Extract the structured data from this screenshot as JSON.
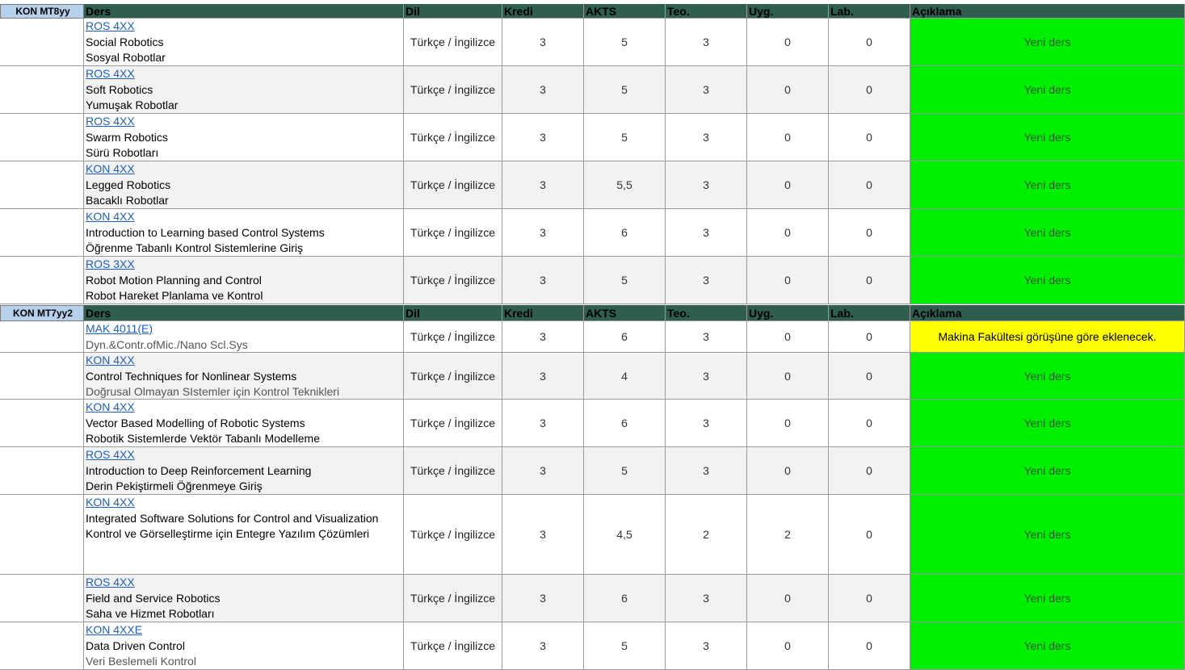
{
  "sections": [
    {
      "label": "KON MT8yy",
      "headers": [
        "Ders",
        "Dil",
        "Kredi",
        "AKTS",
        "Teo.",
        "Uyg.",
        "Lab.",
        "Açıklama"
      ],
      "rows": [
        {
          "code": "ROS 4XX ",
          "en": "Social Robotics",
          "tr": "Sosyal Robotlar",
          "dil": "Türkçe / İngilizce",
          "kredi": "3",
          "akts": "5",
          "teo": "3",
          "uyg": "0",
          "lab": "0",
          "aciklama": "Yeni ders",
          "status": "green"
        },
        {
          "code": "ROS 4XX ",
          "en": "Soft Robotics",
          "tr": "Yumuşak Robotlar",
          "dil": "Türkçe / İngilizce",
          "kredi": "3",
          "akts": "5",
          "teo": "3",
          "uyg": "0",
          "lab": "0",
          "aciklama": "Yeni ders",
          "status": "green"
        },
        {
          "code": "ROS 4XX ",
          "en": "Swarm Robotics",
          "tr": "Sürü Robotları",
          "dil": "Türkçe / İngilizce",
          "kredi": "3",
          "akts": "5",
          "teo": "3",
          "uyg": "0",
          "lab": "0",
          "aciklama": "Yeni ders",
          "status": "green"
        },
        {
          "code": "KON 4XX",
          "en": "Legged Robotics",
          "tr": "Bacaklı Robotlar",
          "dil": "Türkçe / İngilizce",
          "kredi": "3",
          "akts": "5,5",
          "teo": "3",
          "uyg": "0",
          "lab": "0",
          "aciklama": "Yeni ders",
          "status": "green"
        },
        {
          "code": "KON 4XX",
          "en": "Introduction to Learning based Control Systems",
          "tr": "Öğrenme Tabanlı Kontrol Sistemlerine Giriş",
          "dil": "Türkçe / İngilizce",
          "kredi": "3",
          "akts": "6",
          "teo": "3",
          "uyg": "0",
          "lab": "0",
          "aciklama": "Yeni ders",
          "status": "green"
        },
        {
          "code": "ROS 3XX",
          "en": "Robot Motion Planning and Control",
          "tr": "Robot Hareket Planlama ve Kontrol",
          "dil": "Türkçe / İngilizce",
          "kredi": "3",
          "akts": "5",
          "teo": "3",
          "uyg": "0",
          "lab": "0",
          "aciklama": "Yeni ders",
          "status": "green"
        }
      ]
    },
    {
      "label": "KON MT7yy2",
      "headers": [
        "Ders",
        "Dil",
        "Kredi",
        "AKTS",
        "Teo.",
        "Uyg.",
        "Lab.",
        "Açıklama"
      ],
      "rows": [
        {
          "code": "MAK 4011(E)",
          "en": "Dyn.&Contr.ofMic./Nano Scl.Sys",
          "tr": "",
          "dil": "Türkçe / İngilizce",
          "kredi": "3",
          "akts": "6",
          "teo": "3",
          "uyg": "0",
          "lab": "0",
          "aciklama": "Makina Fakültesi görüşüne göre eklenecek.",
          "status": "yellow"
        },
        {
          "code": "KON 4XX",
          "en": "Control Techniques for Nonlinear Systems",
          "tr": "Doğrusal Olmayan SIstemler için Kontrol Teknikleri",
          "dil": "Türkçe / İngilizce",
          "kredi": "3",
          "akts": "4",
          "teo": "3",
          "uyg": "0",
          "lab": "0",
          "aciklama": "Yeni ders",
          "status": "green"
        },
        {
          "code": "KON 4XX",
          "en": "Vector Based Modelling of Robotic Systems",
          "tr": "Robotik Sistemlerde Vektör Tabanlı Modelleme",
          "dil": "Türkçe / İngilizce",
          "kredi": "3",
          "akts": "6",
          "teo": "3",
          "uyg": "0",
          "lab": "0",
          "aciklama": "Yeni ders",
          "status": "green"
        },
        {
          "code": "ROS 4XX ",
          "en": "Introduction to Deep Reinforcement Learning",
          "tr": "Derin Pekiştirmeli Öğrenmeye Giriş",
          "dil": "Türkçe / İngilizce",
          "kredi": "3",
          "akts": "5",
          "teo": "3",
          "uyg": "0",
          "lab": "0",
          "aciklama": "Yeni ders",
          "status": "green"
        },
        {
          "code": "KON 4XX",
          "en": "Integrated Software Solutions for Control and Visualization",
          "tr": "Kontrol ve Görselleştirme için Entegre Yazılım Çözümleri",
          "dil": "Türkçe / İngilizce",
          "kredi": "3",
          "akts": "4,5",
          "teo": "2",
          "uyg": "2",
          "lab": "0",
          "aciklama": "Yeni ders",
          "status": "green"
        },
        {
          "code": "ROS 4XX",
          "en": "Field and Service Robotics",
          "tr": "Saha ve Hizmet Robotları",
          "dil": "Türkçe / İngilizce",
          "kredi": "3",
          "akts": "6",
          "teo": "3",
          "uyg": "0",
          "lab": "0",
          "aciklama": "Yeni ders",
          "status": "green"
        },
        {
          "code": "KON 4XXE ",
          "en": "Data Driven Control",
          "tr": "Veri Beslemeli Kontrol",
          "dil": "Türkçe / İngilizce",
          "kredi": "3",
          "akts": "5",
          "teo": "3",
          "uyg": "0",
          "lab": "0",
          "aciklama": "Yeni ders",
          "status": "green"
        }
      ]
    }
  ],
  "colors": {
    "header": "#2f5d4f",
    "label": "#b7d0ec",
    "green": "#00ee00",
    "yellow": "#ffff00",
    "link": "#1f5fbf"
  }
}
